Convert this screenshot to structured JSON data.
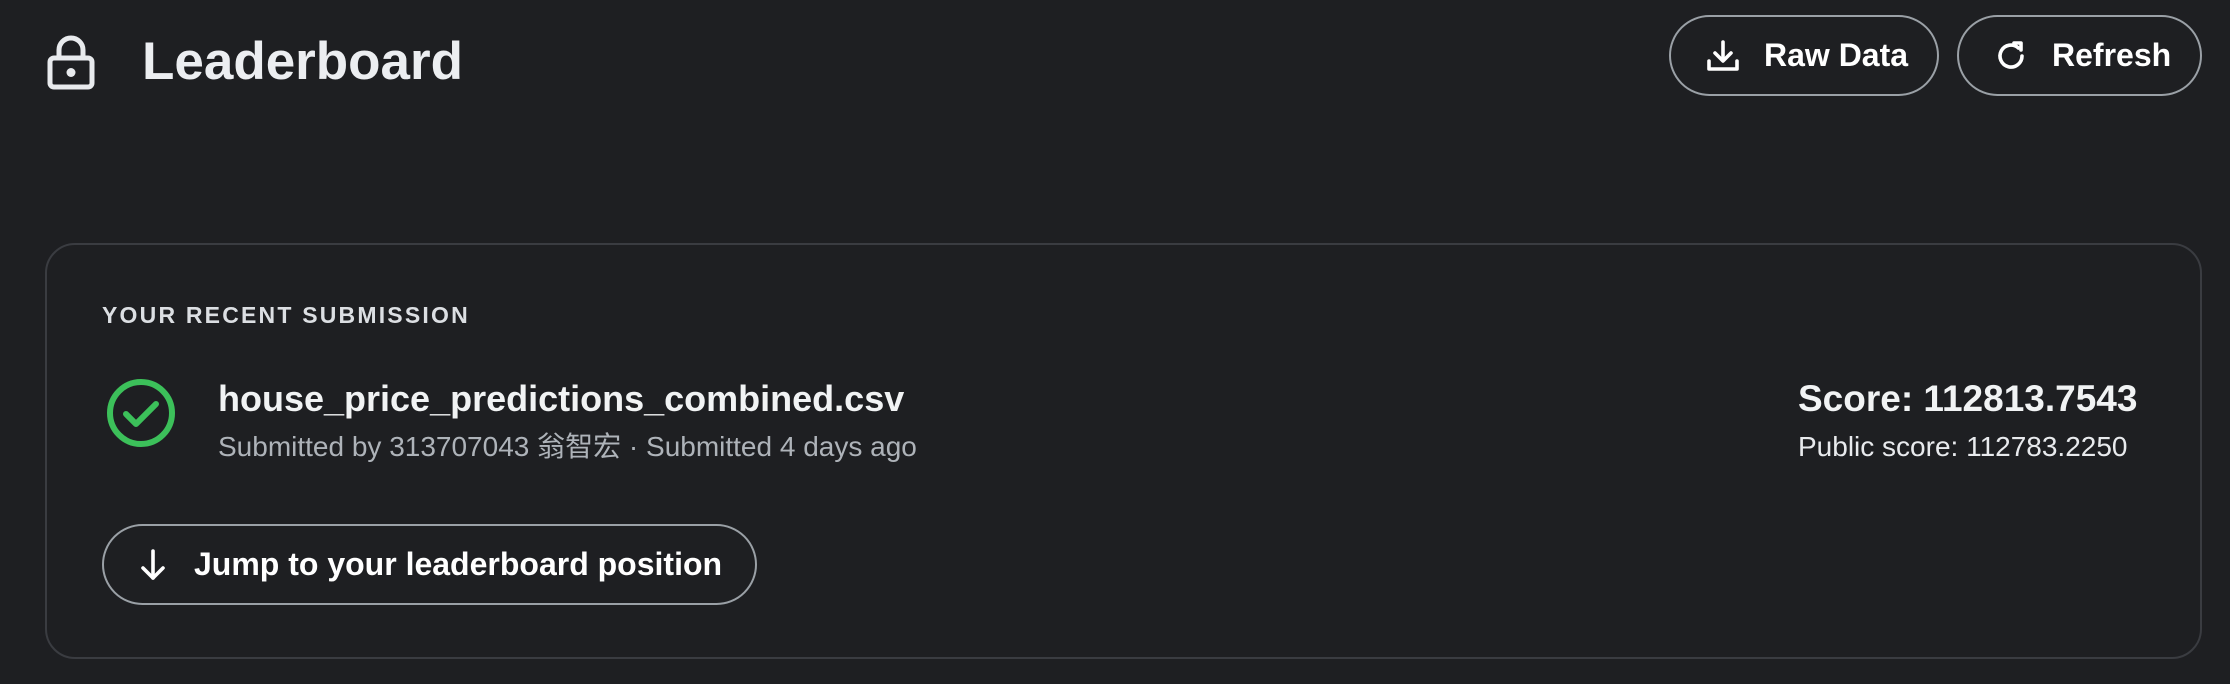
{
  "header": {
    "title": "Leaderboard",
    "title_icon": "lock-icon",
    "raw_data_button": {
      "label": "Raw Data",
      "icon": "download-icon"
    },
    "refresh_button": {
      "label": "Refresh",
      "icon": "refresh-icon"
    }
  },
  "submission": {
    "section_label": "YOUR RECENT SUBMISSION",
    "status_icon": "check-circle-icon",
    "file_name": "house_price_predictions_combined.csv",
    "meta": "Submitted by 313707043 翁智宏 · Submitted 4 days ago",
    "score": "Score: 112813.7543",
    "public_score": "Public score: 112783.2250",
    "jump_button": {
      "label": "Jump to your leaderboard position",
      "icon": "arrow-down-icon"
    }
  },
  "colors": {
    "background": "#1e1f22",
    "card_border": "#3a3c41",
    "success": "#3cc05a",
    "text_primary": "#f1f3f4",
    "text_secondary": "#aeb3b9"
  }
}
